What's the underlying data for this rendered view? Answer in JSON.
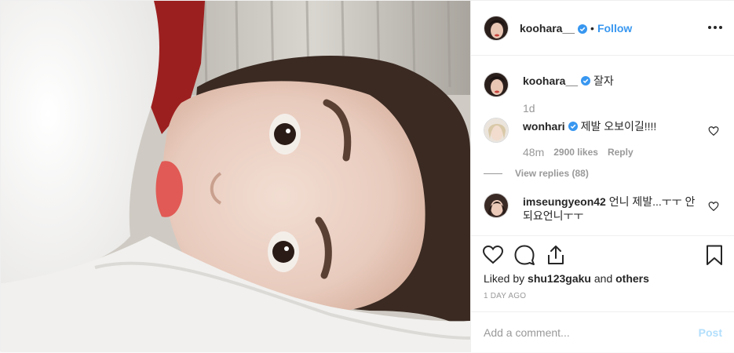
{
  "post": {
    "author": "koohara__",
    "follow_label": "Follow",
    "separator": "•",
    "verified_icon": "verified-badge-icon",
    "more_icon": "more-options-icon"
  },
  "caption": {
    "username": "koohara__",
    "text": "잘자",
    "age": "1d"
  },
  "comments": [
    {
      "username": "wonhari",
      "verified": true,
      "text": "제발 오보이길!!!!",
      "age": "48m",
      "likes": "2900 likes",
      "reply_label": "Reply",
      "view_replies": "View replies (88)"
    },
    {
      "username": "imseungyeon42",
      "verified": false,
      "text": "언니 제발...ㅜㅜ 안되요언니ㅜㅜ"
    }
  ],
  "actions": {
    "like_icon": "heart-icon",
    "comment_icon": "comment-icon",
    "share_icon": "share-icon",
    "save_icon": "bookmark-icon"
  },
  "liked_by": {
    "prefix": "Liked by",
    "user": "shu123gaku",
    "and": "and",
    "others": "others"
  },
  "date": "1 DAY AGO",
  "comment_box": {
    "placeholder": "Add a comment...",
    "post_label": "Post"
  },
  "colors": {
    "link_blue": "#3897f0",
    "post_disabled": "#b2dffc",
    "muted": "#999999",
    "border": "#efefef"
  }
}
